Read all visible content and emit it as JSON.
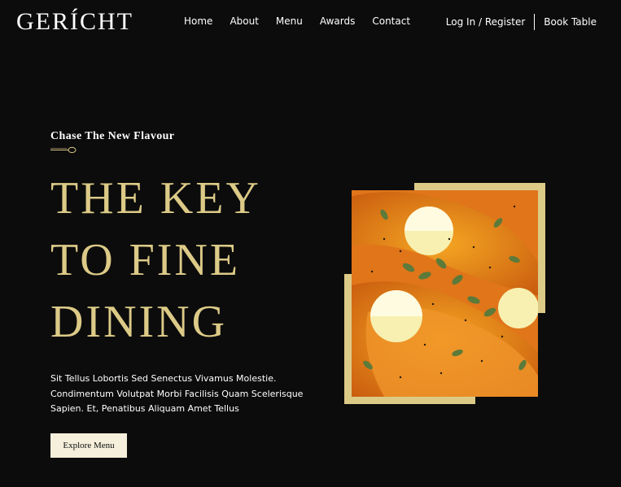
{
  "header": {
    "logo": "GERÍCHT",
    "nav": [
      {
        "label": "Home"
      },
      {
        "label": "About"
      },
      {
        "label": "Menu"
      },
      {
        "label": "Awards"
      },
      {
        "label": "Contact"
      }
    ],
    "login_label": "Log In / Register",
    "book_label": "Book Table"
  },
  "hero": {
    "subtitle": "Chase The New Flavour",
    "headline_lines": [
      "THE KEY",
      "TO FINE",
      "DINING"
    ],
    "description": "Sit Tellus Lobortis Sed Senectus Vivamus Molestie. Condimentum Volutpat Morbi Facilisis Quam Scelerisque Sapien. Et, Penatibus Aliquam Amet Tellus",
    "cta_label": "Explore Menu"
  },
  "colors": {
    "background": "#0c0c0c",
    "gold": "#dcca87",
    "cream": "#f5efdb",
    "text": "#ffffff"
  },
  "icons": {
    "spoon": "spoon-icon"
  }
}
